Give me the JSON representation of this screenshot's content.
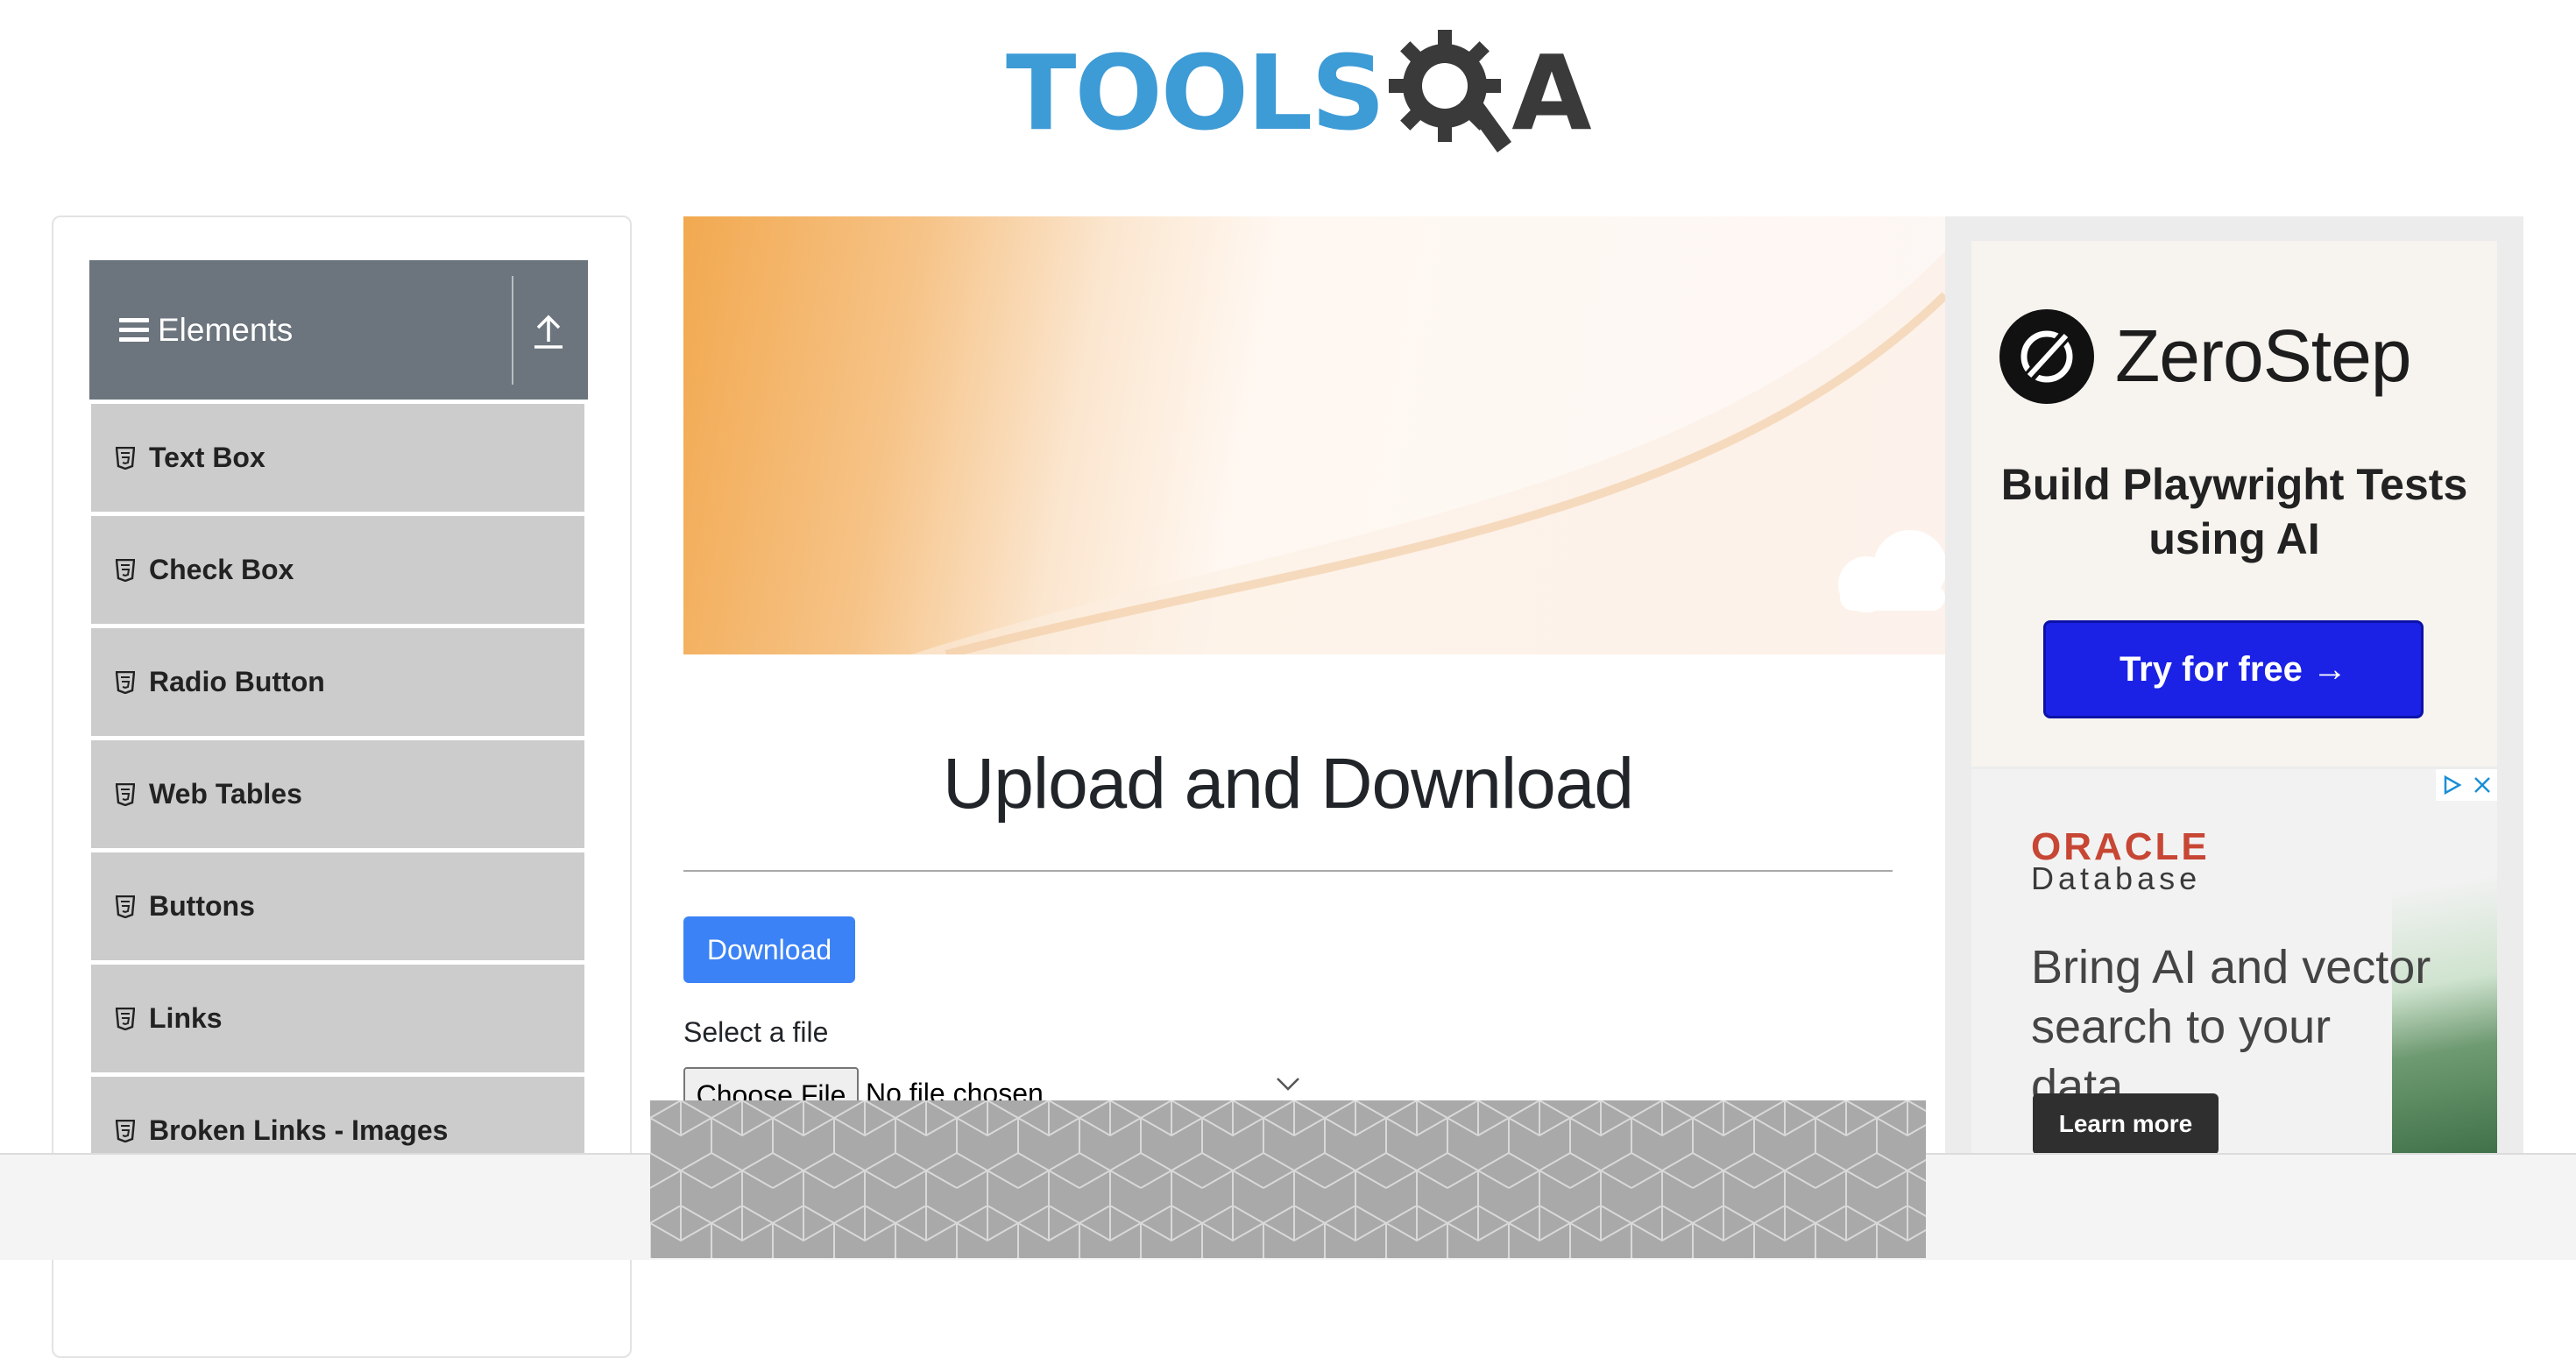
{
  "logo": {
    "tools": "TOOLS",
    "a": "A"
  },
  "sidebar": {
    "group_title": "Elements",
    "items": [
      {
        "label": "Text Box"
      },
      {
        "label": "Check Box"
      },
      {
        "label": "Radio Button"
      },
      {
        "label": "Web Tables"
      },
      {
        "label": "Buttons"
      },
      {
        "label": "Links"
      },
      {
        "label": "Broken Links - Images"
      }
    ]
  },
  "main": {
    "title": "Upload and Download",
    "download_label": "Download",
    "select_label": "Select a file",
    "choose_file_label": "Choose File",
    "no_file_text": "No file chosen"
  },
  "ads": {
    "zerostep": {
      "name": "ZeroStep",
      "headline": "Build Playwright Tests using AI",
      "button": "Try for free →"
    },
    "oracle": {
      "brand": "ORACLE",
      "product": "Database",
      "headline": "Bring AI and vector search to your data",
      "button": "Learn more"
    }
  },
  "colors": {
    "logo_blue": "#3d9bd6",
    "sidebar_header": "#6c757d",
    "menu_item_bg": "#cccccc",
    "primary_button": "#3b82f6",
    "zerostep_button": "#1b22e6",
    "oracle_red": "#c74634"
  },
  "icons": {
    "group": "hamburger-icon",
    "toggle": "upload-arrow-icon",
    "menu_item": "html5-icon",
    "ad_choices": "ad-choices-icon",
    "ad_close": "close-icon"
  }
}
